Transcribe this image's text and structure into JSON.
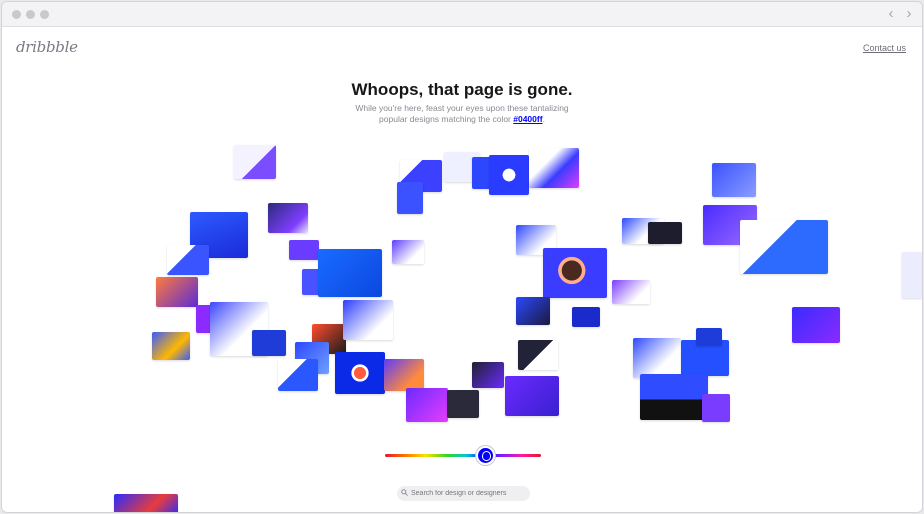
{
  "window": {
    "nav": {
      "back_icon": "chevron-left-icon",
      "forward_icon": "chevron-right-icon",
      "back_glyph": "‹",
      "forward_glyph": "›"
    }
  },
  "header": {
    "logo": "dribbble",
    "contact_link": "Contact us"
  },
  "main": {
    "headline": "Whoops, that page is gone.",
    "subtitle_line1": "While you're here, feast your eyes upon these tantalizing",
    "subtitle_line2_prefix": "popular designs matching the color ",
    "color_link": "#0400ff",
    "subtitle_line2_suffix": "."
  },
  "color_slider": {
    "selected_color": "#0400ff",
    "thumb_icon": "dribbble-ball-icon"
  },
  "search": {
    "placeholder": "Search for design or designers",
    "icon": "search-icon"
  },
  "colors": {
    "accent": "#0400ff",
    "brand_gray": "#7a7a84"
  }
}
